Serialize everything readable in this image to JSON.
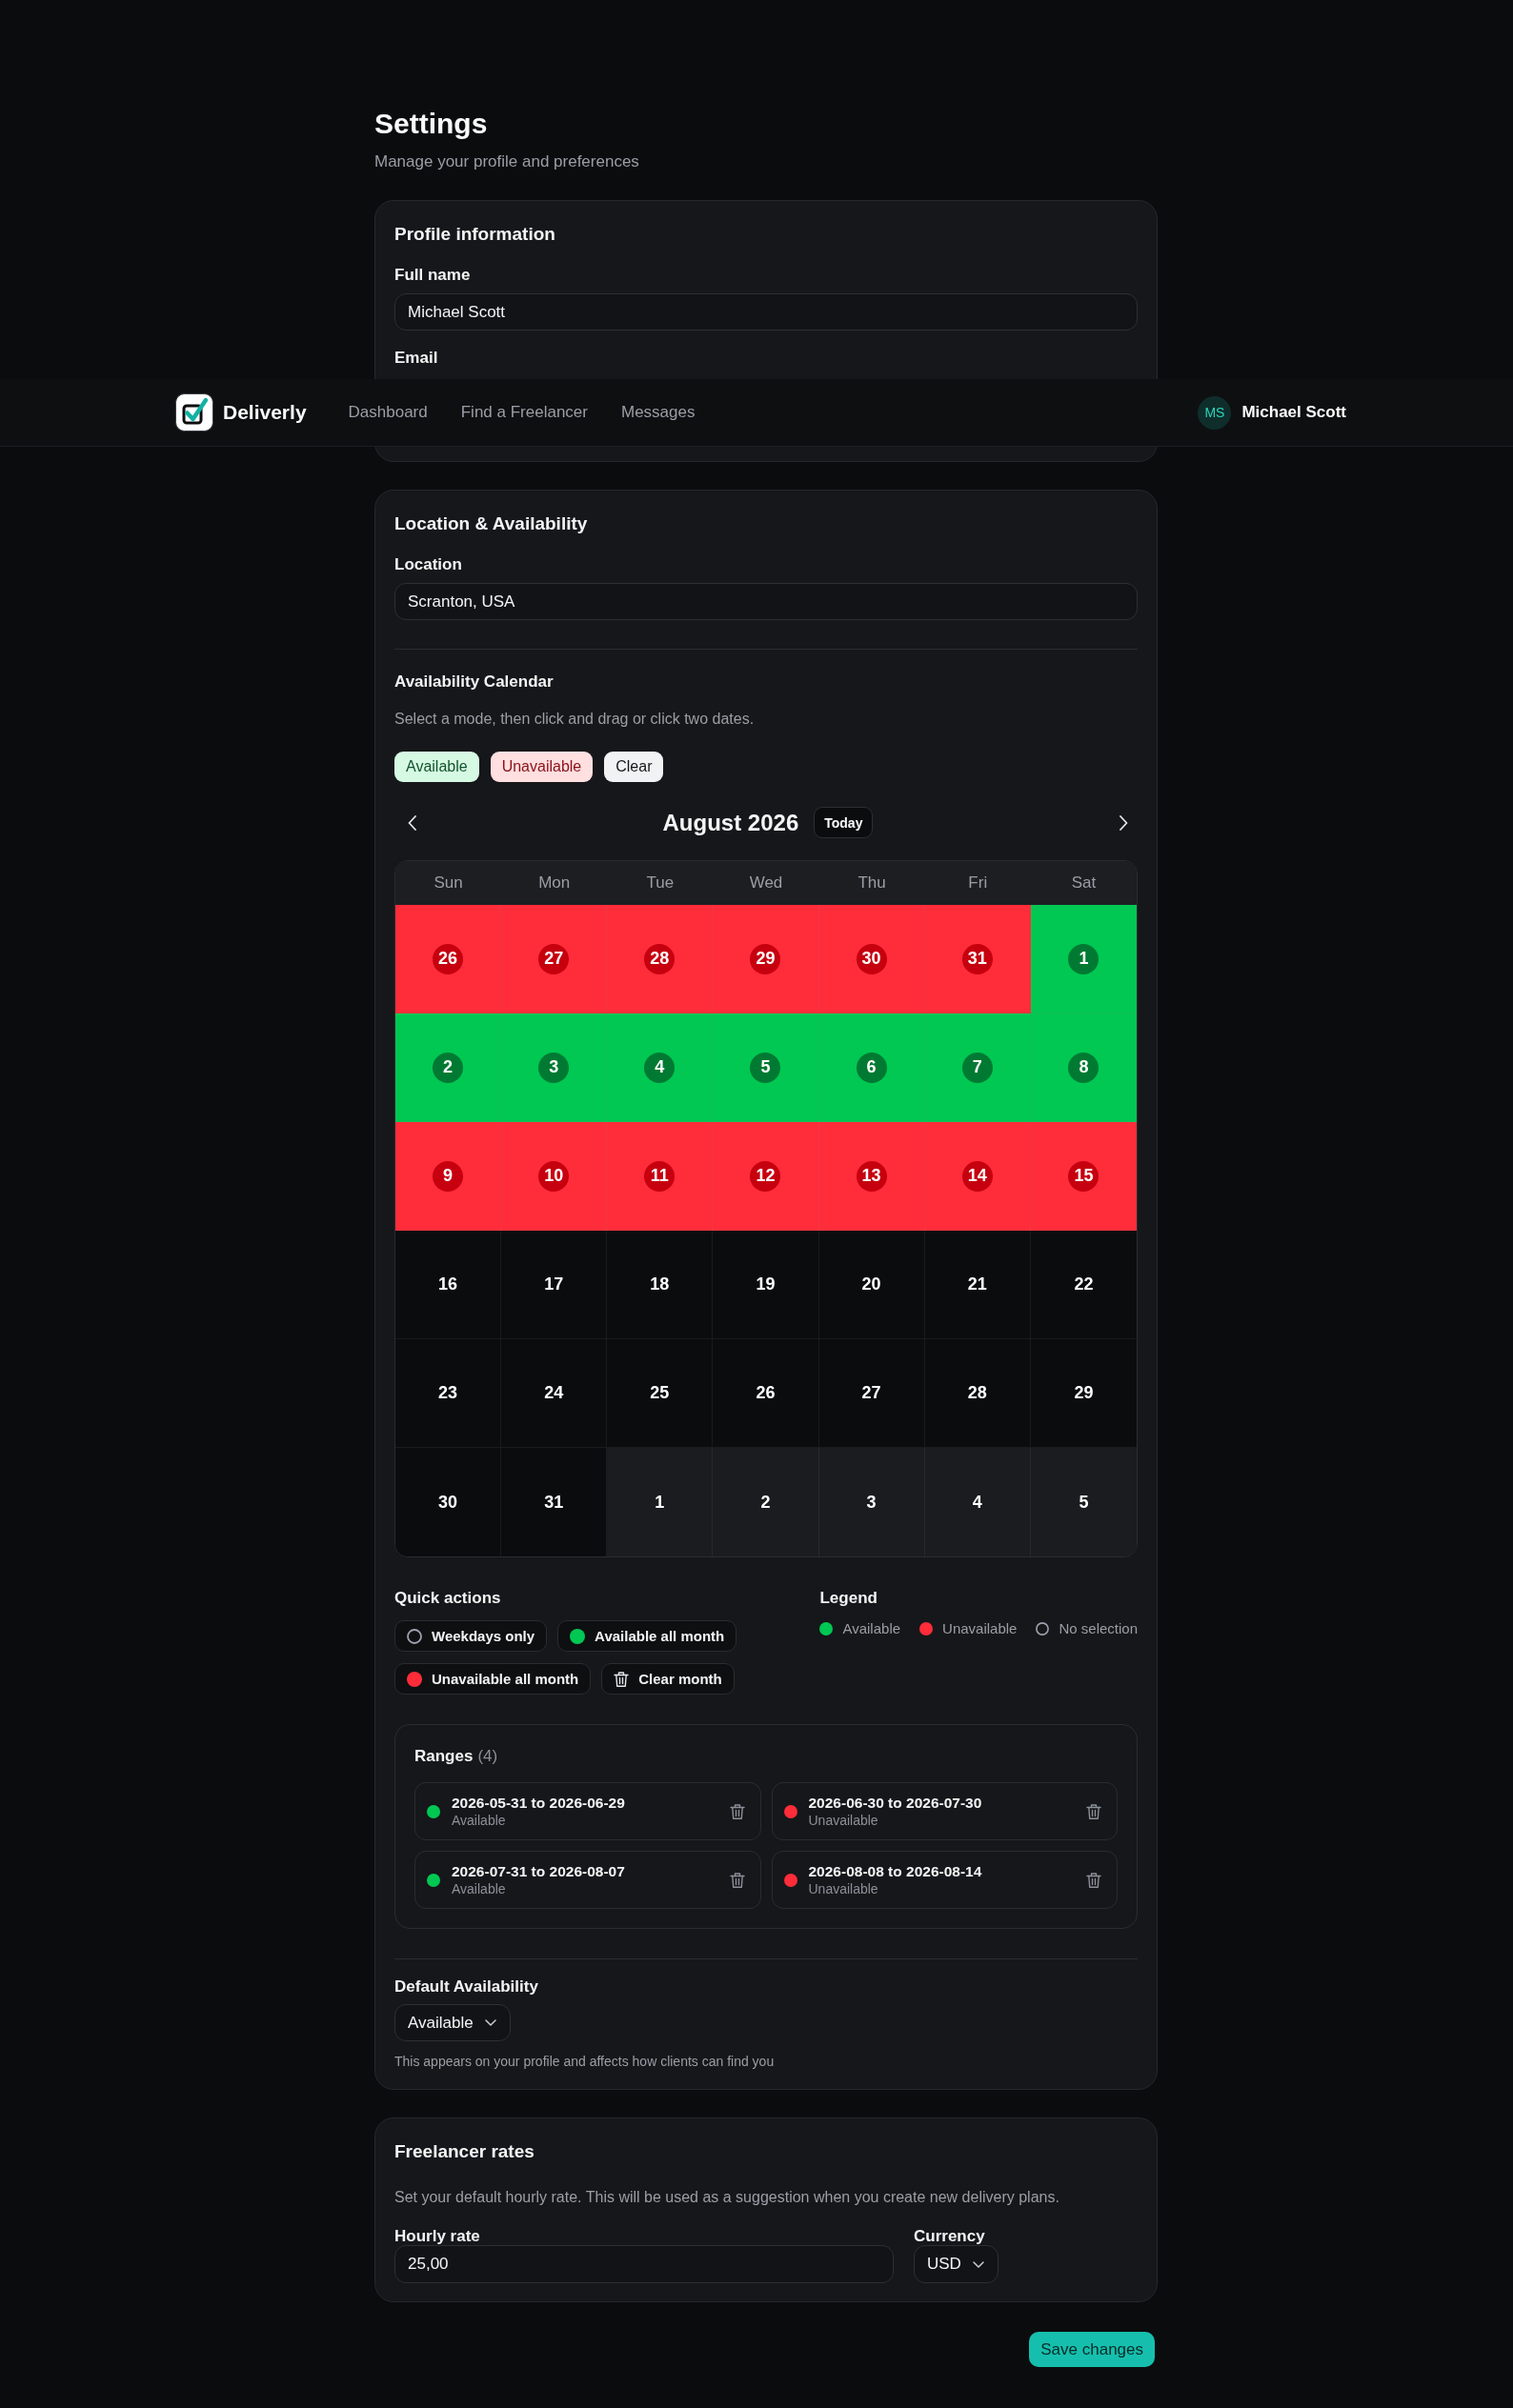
{
  "page": {
    "title": "Settings",
    "subtitle": "Manage your profile and preferences"
  },
  "navbar": {
    "brand": "Deliverly",
    "links": [
      {
        "label": "Dashboard"
      },
      {
        "label": "Find a Freelancer"
      },
      {
        "label": "Messages"
      }
    ],
    "user": {
      "initials": "MS",
      "name": "Michael Scott"
    }
  },
  "profile": {
    "title": "Profile information",
    "fields": [
      {
        "label": "Full name",
        "value": "Michael Scott"
      },
      {
        "label": "Email"
      }
    ]
  },
  "location": {
    "title": "Location & Availability",
    "location_label": "Location",
    "location_value": "Scranton, USA",
    "calendar_title": "Availability Calendar",
    "calendar_help": "Select a mode, then click and drag or click two dates.",
    "modes": [
      {
        "label": "Available",
        "kind": "available"
      },
      {
        "label": "Unavailable",
        "kind": "unavailable"
      },
      {
        "label": "Clear",
        "kind": "clear"
      }
    ],
    "calendar": {
      "month": "August 2026",
      "today_label": "Today",
      "weekdays": [
        "Sun",
        "Mon",
        "Tue",
        "Wed",
        "Thu",
        "Fri",
        "Sat"
      ],
      "days": [
        {
          "label": "26",
          "kind": "unavailable"
        },
        {
          "label": "27",
          "kind": "unavailable"
        },
        {
          "label": "28",
          "kind": "unavailable"
        },
        {
          "label": "29",
          "kind": "unavailable"
        },
        {
          "label": "30",
          "kind": "unavailable"
        },
        {
          "label": "31",
          "kind": "unavailable"
        },
        {
          "label": "1",
          "kind": "available"
        },
        {
          "label": "2",
          "kind": "available"
        },
        {
          "label": "3",
          "kind": "available"
        },
        {
          "label": "4",
          "kind": "available"
        },
        {
          "label": "5",
          "kind": "available"
        },
        {
          "label": "6",
          "kind": "available"
        },
        {
          "label": "7",
          "kind": "available"
        },
        {
          "label": "8",
          "kind": "available"
        },
        {
          "label": "9",
          "kind": "unavailable"
        },
        {
          "label": "10",
          "kind": "unavailable"
        },
        {
          "label": "11",
          "kind": "unavailable"
        },
        {
          "label": "12",
          "kind": "unavailable"
        },
        {
          "label": "13",
          "kind": "unavailable"
        },
        {
          "label": "14",
          "kind": "unavailable"
        },
        {
          "label": "15",
          "kind": "unavailable"
        },
        {
          "label": "16",
          "kind": "empty"
        },
        {
          "label": "17",
          "kind": "empty"
        },
        {
          "label": "18",
          "kind": "empty"
        },
        {
          "label": "19",
          "kind": "empty"
        },
        {
          "label": "20",
          "kind": "empty"
        },
        {
          "label": "21",
          "kind": "empty"
        },
        {
          "label": "22",
          "kind": "empty"
        },
        {
          "label": "23",
          "kind": "empty"
        },
        {
          "label": "24",
          "kind": "empty"
        },
        {
          "label": "25",
          "kind": "empty"
        },
        {
          "label": "26",
          "kind": "empty"
        },
        {
          "label": "27",
          "kind": "empty"
        },
        {
          "label": "28",
          "kind": "empty"
        },
        {
          "label": "29",
          "kind": "empty"
        },
        {
          "label": "30",
          "kind": "empty"
        },
        {
          "label": "31",
          "kind": "empty"
        },
        {
          "label": "1",
          "kind": "other_month"
        },
        {
          "label": "2",
          "kind": "other_month"
        },
        {
          "label": "3",
          "kind": "other_month"
        },
        {
          "label": "4",
          "kind": "other_month"
        },
        {
          "label": "5",
          "kind": "other_month"
        }
      ]
    },
    "quick_actions": {
      "title": "Quick actions",
      "actions": [
        {
          "label": "Weekdays only",
          "kind": "circle"
        },
        {
          "label": "Available all month",
          "kind": "dot",
          "color": "#00c853"
        },
        {
          "label": "Unavailable all month",
          "kind": "dot",
          "color": "#ff2c3a"
        },
        {
          "label": "Clear month",
          "kind": "trash"
        }
      ]
    },
    "legend": {
      "title": "Legend",
      "items": [
        {
          "label": "Available",
          "kind": "dot",
          "color": "#00c853"
        },
        {
          "label": "Unavailable",
          "kind": "dot",
          "color": "#ff2c3a"
        },
        {
          "label": "No selection",
          "kind": "circle"
        }
      ]
    },
    "ranges": {
      "title": "Ranges",
      "count": "(4)",
      "items": [
        {
          "dates": "2026-05-31 to 2026-06-29",
          "status": "Available",
          "color": "#00c853"
        },
        {
          "dates": "2026-06-30 to 2026-07-30",
          "status": "Unavailable",
          "color": "#ff2c3a"
        },
        {
          "dates": "2026-07-31 to 2026-08-07",
          "status": "Available",
          "color": "#00c853"
        },
        {
          "dates": "2026-08-08 to 2026-08-14",
          "status": "Unavailable",
          "color": "#ff2c3a"
        }
      ]
    },
    "default_availability": {
      "label": "Default Availability",
      "value": "Available",
      "help": "This appears on your profile and affects how clients can find you"
    }
  },
  "rates": {
    "title": "Freelancer rates",
    "description": "Set your default hourly rate. This will be used as a suggestion when you create new delivery plans.",
    "hourly_label": "Hourly rate",
    "hourly_value": "25,00",
    "currency_label": "Currency",
    "currency_value": "USD"
  },
  "save_button": "Save changes"
}
